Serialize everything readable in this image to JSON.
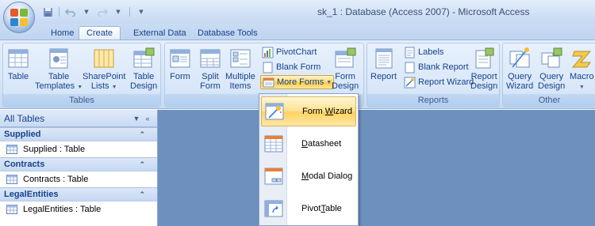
{
  "window": {
    "title": "sk_1 : Database (Access 2007) - Microsoft Access"
  },
  "qat": {
    "save_icon": "save-icon",
    "undo_icon": "undo-icon",
    "redo_icon": "redo-icon",
    "customize_icon": "customize-qat-icon"
  },
  "tabs": [
    {
      "label": "Home"
    },
    {
      "label": "Create"
    },
    {
      "label": "External Data"
    },
    {
      "label": "Database Tools"
    }
  ],
  "ribbon": {
    "tables": {
      "group_label": "Tables",
      "table": "Table",
      "table_templates_1": "Table",
      "table_templates_2": "Templates",
      "sharepoint_1": "SharePoint",
      "sharepoint_2": "Lists",
      "table_design_1": "Table",
      "table_design_2": "Design"
    },
    "forms": {
      "group_label": "Fo",
      "form": "Form",
      "split_1": "Split",
      "split_2": "Form",
      "multiple_1": "Multiple",
      "multiple_2": "Items",
      "pivotchart": "PivotChart",
      "blank_form": "Blank Form",
      "more_forms": "More Forms",
      "form_design_1": "Form",
      "form_design_2": "Design"
    },
    "reports": {
      "group_label": "Reports",
      "report": "Report",
      "labels": "Labels",
      "blank_report": "Blank Report",
      "report_wizard": "Report Wizard",
      "report_design_1": "Report",
      "report_design_2": "Design"
    },
    "other": {
      "group_label": "Other",
      "query_wizard_1": "Query",
      "query_wizard_2": "Wizard",
      "query_design_1": "Query",
      "query_design_2": "Design",
      "macro": "Macro"
    }
  },
  "navpane": {
    "header": "All Tables",
    "groups": [
      {
        "name": "Supplied",
        "item": "Supplied : Table"
      },
      {
        "name": "Contracts",
        "item": "Contracts : Table"
      },
      {
        "name": "LegalEntities",
        "item": "LegalEntities : Table"
      }
    ]
  },
  "more_forms_menu": [
    {
      "pre": "Form ",
      "accel": "W",
      "post": "izard"
    },
    {
      "pre": "",
      "accel": "D",
      "post": "atasheet"
    },
    {
      "pre": "",
      "accel": "M",
      "post": "odal Dialog"
    },
    {
      "pre": "Pivot",
      "accel": "T",
      "post": "able"
    }
  ],
  "colors": {
    "accent": "#15428b",
    "highlight": "#ffd25e",
    "workspace": "#6d90bf"
  }
}
